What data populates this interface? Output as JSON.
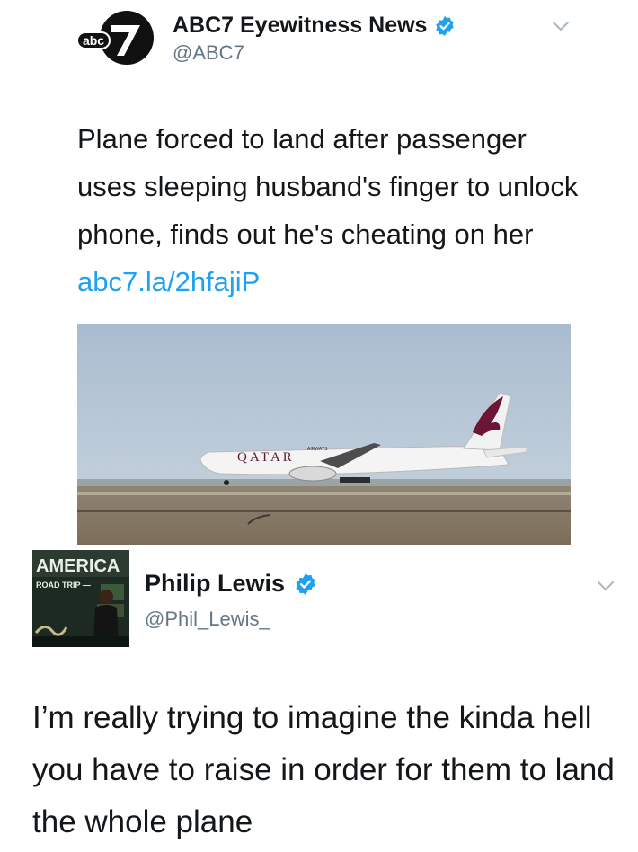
{
  "tweet1": {
    "avatar_text": "abc",
    "avatar_number": "7",
    "name": "ABC7 Eyewitness News",
    "handle": "@ABC7",
    "text": "Plane forced to land after passenger uses sleeping husband's finger to unlock phone, finds out he's cheating on her ",
    "link": "abc7.la/2hfajiP",
    "photo": {
      "airline_livery": "QATAR",
      "livery_small": "AIRWAYS"
    }
  },
  "tweet2": {
    "avatar_sign": "AMERICA",
    "avatar_sub": "ROAD TRIP —",
    "name": "Philip Lewis",
    "handle": "@Phil_Lewis_",
    "text": "I’m really trying to imagine the kinda hell you have to raise in order for them to land the whole plane"
  },
  "colors": {
    "verified_blue": "#1da1f2",
    "link_blue": "#1da1f2",
    "handle_gray": "#657786",
    "abc_black": "#111111"
  },
  "icons": {
    "verified": "verified-badge-icon",
    "caret": "chevron-down-icon"
  }
}
